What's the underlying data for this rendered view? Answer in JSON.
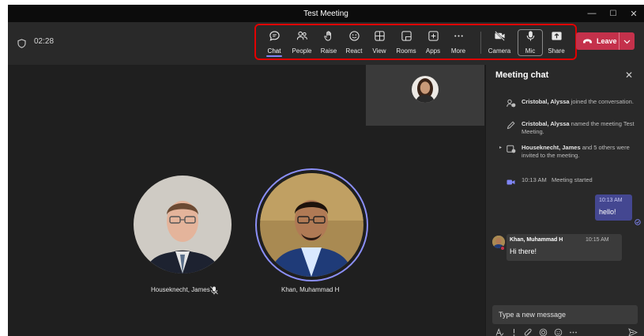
{
  "window": {
    "title": "Test Meeting",
    "minimize": "—",
    "maximize": "☐",
    "close": "✕"
  },
  "meeting": {
    "timer": "02:28"
  },
  "toolbar": {
    "buttons": [
      {
        "label": "Chat",
        "icon": "chat-icon"
      },
      {
        "label": "People",
        "icon": "people-icon"
      },
      {
        "label": "Raise",
        "icon": "raise-hand-icon"
      },
      {
        "label": "React",
        "icon": "emoji-icon"
      },
      {
        "label": "View",
        "icon": "view-grid-icon"
      },
      {
        "label": "Rooms",
        "icon": "rooms-icon"
      },
      {
        "label": "Apps",
        "icon": "apps-icon"
      },
      {
        "label": "More",
        "icon": "more-icon"
      },
      {
        "label": "Camera",
        "icon": "camera-off-icon"
      },
      {
        "label": "Mic",
        "icon": "mic-icon"
      },
      {
        "label": "Share",
        "icon": "share-icon"
      }
    ],
    "leave_label": "Leave",
    "accent": "#c4314b",
    "highlight_color": "#e10000"
  },
  "stage": {
    "participants": [
      {
        "name": "Houseknecht, James"
      },
      {
        "name": "Khan, Muhammad H"
      }
    ]
  },
  "chat": {
    "title": "Meeting chat",
    "events": [
      {
        "actor": "Cristobal, Alyssa",
        "text": " joined the conversation."
      },
      {
        "actor": "Cristobal, Alyssa",
        "text": " named the meeting Test Meeting."
      },
      {
        "actor": "Houseknecht, James",
        "text": " and 5 others were invited to the meeting."
      },
      {
        "time": "10:13 AM",
        "text": "Meeting started"
      }
    ],
    "my_message": {
      "time": "10:13 AM",
      "text": "hello!"
    },
    "their_message": {
      "sender": "Khan, Muhammad H",
      "time": "10:15 AM",
      "text": "Hi there!"
    },
    "compose_placeholder": "Type a new message"
  }
}
